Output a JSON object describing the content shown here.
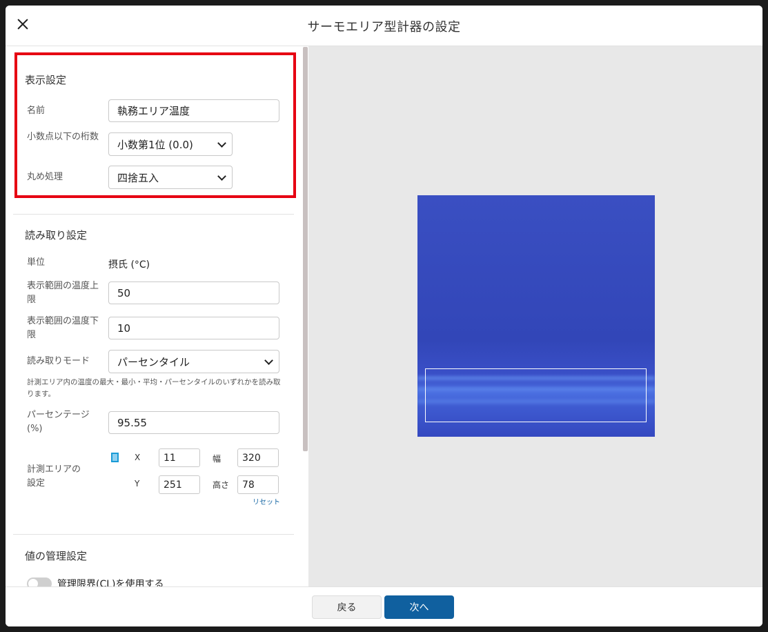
{
  "dialog": {
    "title": "サーモエリア型計器の設定"
  },
  "display_settings": {
    "section_title": "表示設定",
    "name_label": "名前",
    "name_value": "執務エリア温度",
    "decimal_label": "小数点以下の桁数",
    "decimal_value": "小数第1位 (0.0)",
    "rounding_label": "丸め処理",
    "rounding_value": "四捨五入"
  },
  "reading_settings": {
    "section_title": "読み取り設定",
    "unit_label": "単位",
    "unit_value": "摂氏 (°C)",
    "upper_label": "表示範囲の温度上限",
    "upper_value": "50",
    "lower_label": "表示範囲の温度下限",
    "lower_value": "10",
    "mode_label": "読み取りモード",
    "mode_value": "パーセンタイル",
    "mode_help": "計測エリア内の温度の最大・最小・平均・パーセンタイルのいずれかを読み取ります。",
    "percentage_label": "パーセンテージ(%)",
    "percentage_value": "95.55",
    "area_label": "計測エリアの設定",
    "x_label": "X",
    "x_value": "11",
    "y_label": "Y",
    "y_value": "251",
    "width_label": "幅",
    "width_value": "320",
    "height_label": "高さ",
    "height_value": "78",
    "reset_label": "リセット"
  },
  "value_management": {
    "section_title": "値の管理設定",
    "cl_toggle_label": "管理限界(CL)を使用する",
    "cl_toggle_on": false
  },
  "footer": {
    "back_label": "戻る",
    "next_label": "次へ"
  },
  "colors": {
    "primary": "#10609f",
    "highlight": "#e60012",
    "thermal_base": "#3a4fc2"
  },
  "icons": {
    "close": "close-icon",
    "area": "measurement-area-icon",
    "select": "chevron-down-icon"
  }
}
